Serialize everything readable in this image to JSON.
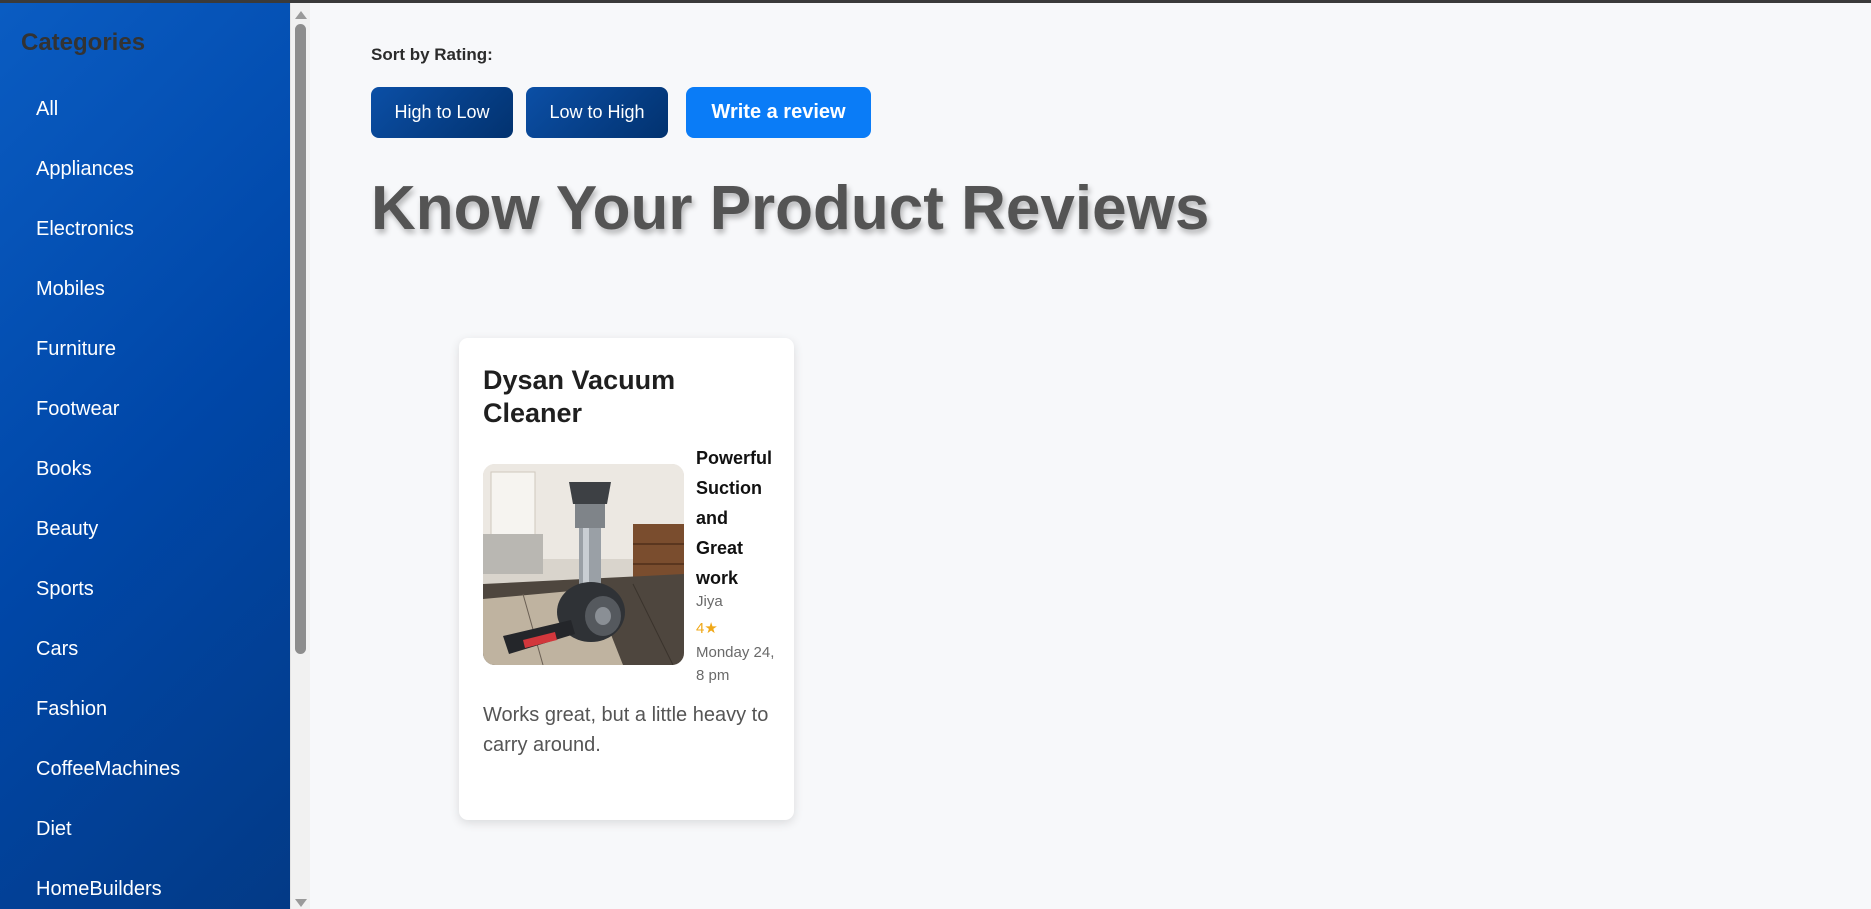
{
  "sidebar": {
    "heading": "Categories",
    "items": [
      {
        "label": "All"
      },
      {
        "label": "Appliances"
      },
      {
        "label": "Electronics"
      },
      {
        "label": "Mobiles"
      },
      {
        "label": "Furniture"
      },
      {
        "label": "Footwear"
      },
      {
        "label": "Books"
      },
      {
        "label": "Beauty"
      },
      {
        "label": "Sports"
      },
      {
        "label": "Cars"
      },
      {
        "label": "Fashion"
      },
      {
        "label": "CoffeeMachines"
      },
      {
        "label": "Diet"
      },
      {
        "label": "HomeBuilders"
      }
    ]
  },
  "sort": {
    "label": "Sort by Rating:",
    "high_to_low": "High to Low",
    "low_to_high": "Low to High"
  },
  "actions": {
    "write_review": "Write a review"
  },
  "page": {
    "title": "Know Your Product Reviews"
  },
  "reviews": [
    {
      "product": "Dysan Vacuum Cleaner",
      "image_icon": "vacuum-cleaner-photo",
      "title": "Powerful Suction and Great work",
      "author": "Jiya",
      "rating": "4★",
      "date": "Monday 24, 8 pm",
      "text": "Works great, but a little heavy to carry around."
    }
  ],
  "colors": {
    "sidebar_accent": "#0047a8",
    "sort_button": "#02326f",
    "write_button": "#0a7cf7",
    "star": "#f0a818"
  }
}
